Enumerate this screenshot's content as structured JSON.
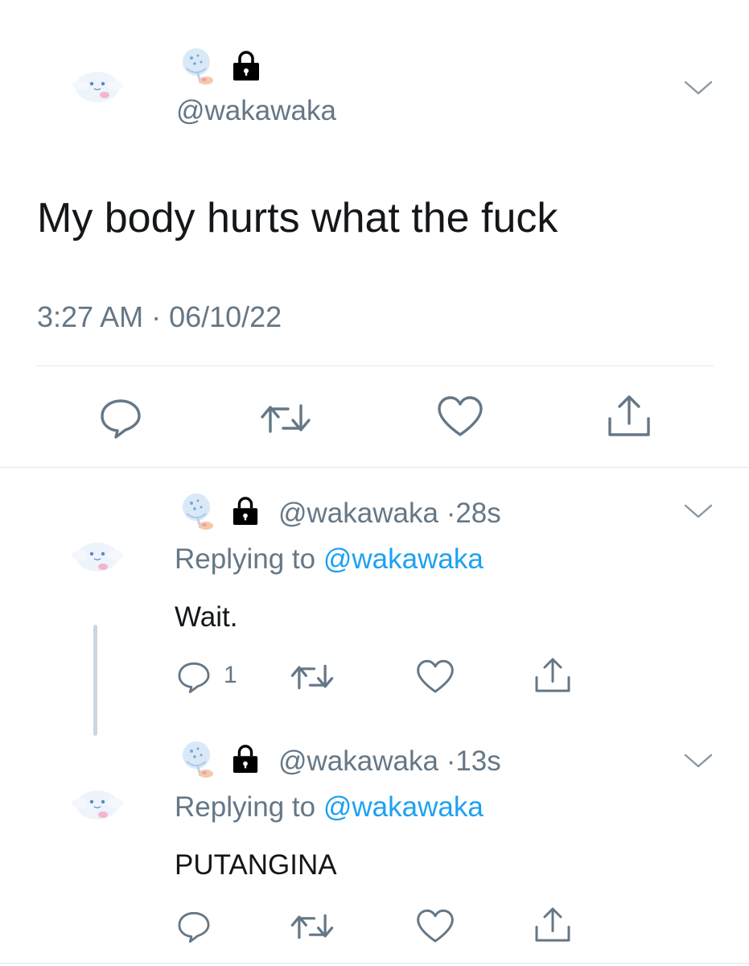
{
  "main_tweet": {
    "handle": "@wakawaka",
    "text": "My body hurts what the fuck",
    "timestamp": "3:27 AM · 06/10/22",
    "avatar_icon": "cinnamoroll-avatar",
    "name_icon": "snow-globe-emoji",
    "protected_icon": "lock-icon"
  },
  "replies": [
    {
      "handle": "@wakawaka",
      "sep": "·",
      "age": "28s",
      "replying_prefix": "Replying to",
      "replying_handle": "@wakawaka",
      "text": "Wait.",
      "reply_count": "1"
    },
    {
      "handle": "@wakawaka",
      "sep": "·",
      "age": "13s",
      "replying_prefix": "Replying to",
      "replying_handle": "@wakawaka",
      "text": "PUTANGINA",
      "reply_count": ""
    }
  ],
  "colors": {
    "text": "#14171a",
    "secondary": "#657786",
    "link": "#1da1f2",
    "divider": "#e1e8ed"
  }
}
